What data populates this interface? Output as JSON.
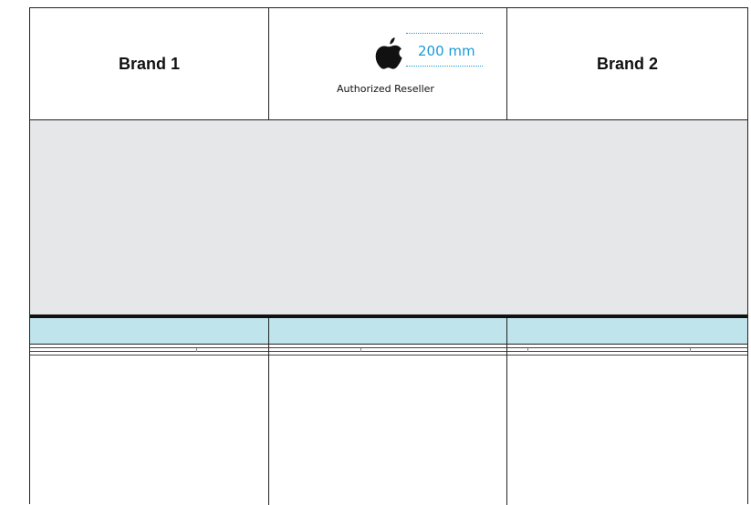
{
  "header": {
    "brand1": "Brand 1",
    "brand2": "Brand 2",
    "apple_logo_icon": "apple-logo-icon",
    "dimension_label": "200 mm",
    "reseller_label": "Authorized Reseller"
  },
  "colors": {
    "accent_blue": "#1a9ad6",
    "gray_band": "#e6e7e8",
    "column_header": "#bfe4ec",
    "line": "#222222"
  }
}
